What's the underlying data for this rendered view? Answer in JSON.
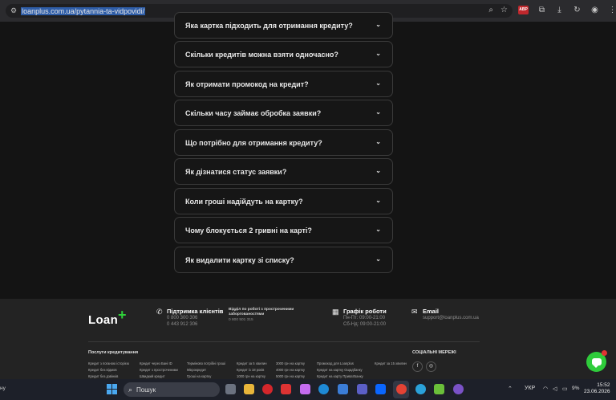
{
  "browser": {
    "url": "loanplus.com.ua/pytannia-ta-vidpovidi/",
    "extension_badge": "ABP"
  },
  "faq": [
    {
      "question": "Яка картка підходить для отримання кредиту?"
    },
    {
      "question": "Скільки кредитів можна взяти одночасно?"
    },
    {
      "question": "Як отримати промокод на кредит?"
    },
    {
      "question": "Скільки часу займає обробка заявки?"
    },
    {
      "question": "Що потрібно для отримання кредиту?"
    },
    {
      "question": "Як дізнатися статус заявки?"
    },
    {
      "question": "Коли гроші надійдуть на картку?"
    },
    {
      "question": "Чому блокується 2 гривні на карті?"
    },
    {
      "question": "Як видалити картку зі списку?"
    }
  ],
  "footer": {
    "logo_text": "Loan",
    "logo_plus": "+",
    "support": {
      "title": "Підтримка клієнтів",
      "phone1": "0 800 300 306",
      "phone2": "0 443 912 306"
    },
    "anti_fraud": {
      "title": "Відділ по роботі з простроченими заборгованостями",
      "phone": "0 800 501 315"
    },
    "schedule": {
      "title": "Графік роботи",
      "weekdays": "Пн-Пт: 09:00-21:00",
      "weekend": "Сб-Нд: 09:00-21:00"
    },
    "email": {
      "title": "Email",
      "address": "support@loanplus.com.ua"
    },
    "services_title": "Послуги кредитування",
    "services_columns": [
      [
        "Кредит з поганою історією",
        "Кредит без відмов",
        "Кредит без дзвінків"
      ],
      [
        "Кредит через Бані ID",
        "Кредит з простроченими",
        "Швидкий кредит"
      ],
      [
        "Терміново потрібні гроші",
        "Мікрокредит",
        "Гроші на картку"
      ],
      [
        "Кредит за 5 хвилин",
        "Кредит із 18 років",
        "1000 грн на картку"
      ],
      [
        "3000 грн на картку",
        "4000 грн на картку",
        "5000 грн на картку"
      ],
      [
        "Промокод для Loanplus",
        "Кредит на картку Ощадбанку",
        "Кредит на карту ПриватБанку"
      ],
      [
        "Кредит за 15 хвилин"
      ]
    ],
    "social_title": "СОЦІАЛЬНІ МЕРЕЖІ",
    "social": [
      {
        "icon": "facebook-icon",
        "glyph": "f"
      },
      {
        "icon": "instagram-icon",
        "glyph": "◎"
      }
    ]
  },
  "taskbar": {
    "left_text": "ну",
    "search_placeholder": "Пошук",
    "language": "УКР",
    "battery": "9%",
    "time": "15:52",
    "date": "23.06.2026"
  }
}
